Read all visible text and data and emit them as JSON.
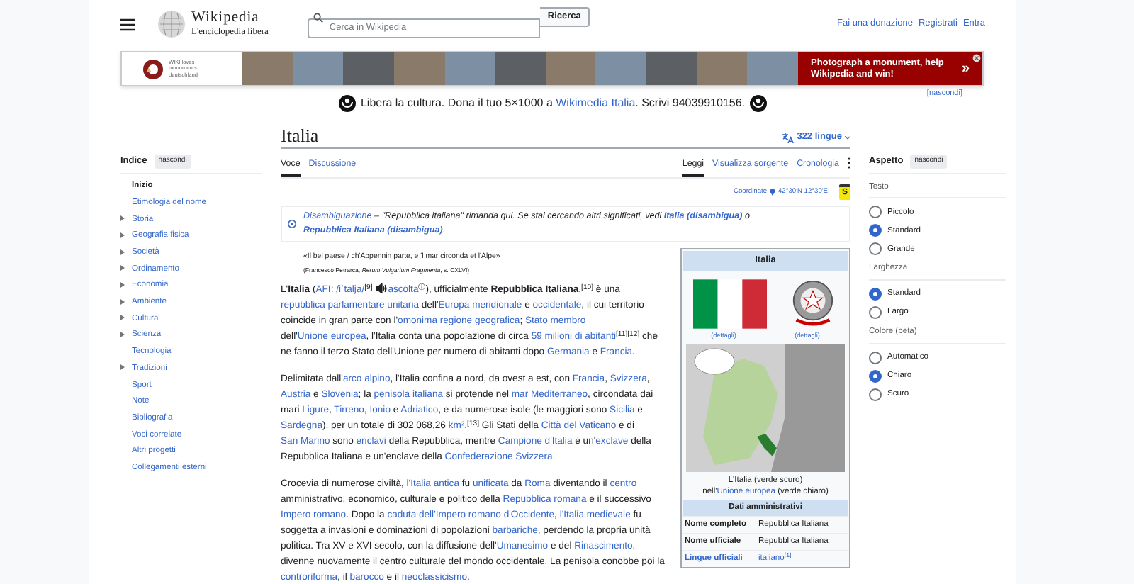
{
  "header": {
    "logo_title": "Wikipedia",
    "logo_tagline": "L'enciclopedia libera",
    "search": {
      "placeholder": "Cerca in Wikipedia",
      "button": "Ricerca"
    },
    "links": [
      "Fai una donazione",
      "Registrati",
      "Entra"
    ]
  },
  "banner": {
    "logo_words": [
      "WIKI loves",
      "monuments",
      "deutschland"
    ],
    "cta": "Photograph a monument, help Wikipedia and win!",
    "cta_arrow": "»"
  },
  "notice": {
    "before": "Libera la cultura. Dona il tuo 5×1000 a ",
    "link": "Wikimedia Italia",
    "after": ". Scrivi 94039910156.",
    "hide": "[nascondi]"
  },
  "toc": {
    "title": "Indice",
    "hide": "nascondi",
    "items": [
      {
        "label": "Inizio",
        "selected": true,
        "expandable": false
      },
      {
        "label": "Etimologia del nome",
        "selected": false,
        "expandable": false
      },
      {
        "label": "Storia",
        "selected": false,
        "expandable": true
      },
      {
        "label": "Geografia fisica",
        "selected": false,
        "expandable": true
      },
      {
        "label": "Società",
        "selected": false,
        "expandable": true
      },
      {
        "label": "Ordinamento",
        "selected": false,
        "expandable": true
      },
      {
        "label": "Economia",
        "selected": false,
        "expandable": true
      },
      {
        "label": "Ambiente",
        "selected": false,
        "expandable": true
      },
      {
        "label": "Cultura",
        "selected": false,
        "expandable": true
      },
      {
        "label": "Scienza",
        "selected": false,
        "expandable": true
      },
      {
        "label": "Tecnologia",
        "selected": false,
        "expandable": false
      },
      {
        "label": "Tradizioni",
        "selected": false,
        "expandable": true
      },
      {
        "label": "Sport",
        "selected": false,
        "expandable": false
      },
      {
        "label": "Note",
        "selected": false,
        "expandable": false
      },
      {
        "label": "Bibliografia",
        "selected": false,
        "expandable": false
      },
      {
        "label": "Voci correlate",
        "selected": false,
        "expandable": false
      },
      {
        "label": "Altri progetti",
        "selected": false,
        "expandable": false
      },
      {
        "label": "Collegamenti esterni",
        "selected": false,
        "expandable": false
      }
    ]
  },
  "article": {
    "title": "Italia",
    "languages": "322 lingue",
    "tabs_left": [
      {
        "label": "Voce",
        "selected": true
      },
      {
        "label": "Discussione",
        "selected": false
      }
    ],
    "tabs_right": [
      {
        "label": "Leggi",
        "selected": true
      },
      {
        "label": "Visualizza sorgente",
        "selected": false
      },
      {
        "label": "Cronologia",
        "selected": false
      }
    ],
    "coordinates": {
      "label": "Coordinate",
      "value": "42°30′N 12°30′E",
      "protection": "S"
    },
    "hatnote": [
      {
        "t": "Disambiguazione",
        "link": true
      },
      {
        "t": " – \"Repubblica italiana\" rimanda qui. Se stai cercando altri significati, vedi ",
        "link": false
      },
      {
        "t": "**Italia (disambigua)**",
        "link": true
      },
      {
        "t": " o ",
        "link": false
      },
      {
        "t": "**Repubblica Italiana (disambigua)**",
        "link": true
      },
      {
        "t": ".",
        "link": false
      }
    ],
    "quote": {
      "text": "«Il bel paese / ch'Appennin parte, e 'l mar circonda et l'Alpe»",
      "source": "(Francesco Petrarca, *Rerum Vulgarium Fragmenta*, s. CXLVI)"
    },
    "paragraphs": [
      [
        {
          "t": "L'**Italia** (",
          "link": false
        },
        {
          "t": "AFI",
          "link": true
        },
        {
          "t": ": ",
          "link": false
        },
        {
          "t": "/iˈtalja/",
          "link": true
        },
        {
          "t": "$^{[9]}$ ",
          "link": false
        },
        {
          "t": "ascolta",
          "link": true,
          "audio": true
        },
        {
          "t": "$^{ⓘ}$), ufficialmente **Repubblica Italiana**,$^{[10]}$ è una ",
          "link": false
        },
        {
          "t": "repubblica parlamentare unitaria",
          "link": true
        },
        {
          "t": " dell'",
          "link": false
        },
        {
          "t": "Europa meridionale",
          "link": true
        },
        {
          "t": " e ",
          "link": false
        },
        {
          "t": "occidentale",
          "link": true
        },
        {
          "t": ", il cui territorio coincide in gran parte con l'",
          "link": false
        },
        {
          "t": "omonima regione geografica",
          "link": true
        },
        {
          "t": "; ",
          "link": false
        },
        {
          "t": "Stato membro",
          "link": true
        },
        {
          "t": " dell'",
          "link": false
        },
        {
          "t": "Unione europea",
          "link": true
        },
        {
          "t": ", l'Italia conta una popolazione di circa ",
          "link": false
        },
        {
          "t": "59 milioni di abitanti",
          "link": true
        },
        {
          "t": "$^{[11][12]}$ che ne fanno il terzo Stato dell'Unione per numero di abitanti dopo ",
          "link": false
        },
        {
          "t": "Germania",
          "link": true
        },
        {
          "t": " e ",
          "link": false
        },
        {
          "t": "Francia",
          "link": true
        },
        {
          "t": ".",
          "link": false
        }
      ],
      [
        {
          "t": "Delimitata dall'",
          "link": false
        },
        {
          "t": "arco alpino",
          "link": true
        },
        {
          "t": ", l'Italia confina a nord, da ovest a est, con ",
          "link": false
        },
        {
          "t": "Francia",
          "link": true
        },
        {
          "t": ", ",
          "link": false
        },
        {
          "t": "Svizzera",
          "link": true
        },
        {
          "t": ", ",
          "link": false
        },
        {
          "t": "Austria",
          "link": true
        },
        {
          "t": " e ",
          "link": false
        },
        {
          "t": "Slovenia",
          "link": true
        },
        {
          "t": "; la ",
          "link": false
        },
        {
          "t": "penisola italiana",
          "link": true
        },
        {
          "t": " si protende nel ",
          "link": false
        },
        {
          "t": "mar Mediterraneo",
          "link": true
        },
        {
          "t": ", circondata dai mari ",
          "link": false
        },
        {
          "t": "Ligure",
          "link": true
        },
        {
          "t": ", ",
          "link": false
        },
        {
          "t": "Tirreno",
          "link": true
        },
        {
          "t": ", ",
          "link": false
        },
        {
          "t": "Ionio",
          "link": true
        },
        {
          "t": " e ",
          "link": false
        },
        {
          "t": "Adriatico",
          "link": true
        },
        {
          "t": ", e da numerose isole (le maggiori sono ",
          "link": false
        },
        {
          "t": "Sicilia",
          "link": true
        },
        {
          "t": " e ",
          "link": false
        },
        {
          "t": "Sardegna",
          "link": true
        },
        {
          "t": "), per un totale di 302 068,26 ",
          "link": false
        },
        {
          "t": "km²",
          "link": true
        },
        {
          "t": ".$^{[13]}$ Gli Stati della ",
          "link": false
        },
        {
          "t": "Città del Vaticano",
          "link": true
        },
        {
          "t": " e di ",
          "link": false
        },
        {
          "t": "San Marino",
          "link": true
        },
        {
          "t": " sono ",
          "link": false
        },
        {
          "t": "enclavi",
          "link": true
        },
        {
          "t": " della Repubblica, mentre ",
          "link": false
        },
        {
          "t": "Campione d'Italia",
          "link": true
        },
        {
          "t": " è un'",
          "link": false
        },
        {
          "t": "exclave",
          "link": true
        },
        {
          "t": " della Repubblica Italiana e un'enclave della ",
          "link": false
        },
        {
          "t": "Confederazione Svizzera",
          "link": true
        },
        {
          "t": ".",
          "link": false
        }
      ],
      [
        {
          "t": "Crocevia di numerose civiltà, ",
          "link": false
        },
        {
          "t": "l'Italia antica",
          "link": true
        },
        {
          "t": " fu ",
          "link": false
        },
        {
          "t": "unificata",
          "link": true
        },
        {
          "t": " da ",
          "link": false
        },
        {
          "t": "Roma",
          "link": true
        },
        {
          "t": " diventando il ",
          "link": false
        },
        {
          "t": "centro",
          "link": true
        },
        {
          "t": " amministrativo, economico, culturale e politico della ",
          "link": false
        },
        {
          "t": "Repubblica romana",
          "link": true
        },
        {
          "t": " e il successivo ",
          "link": false
        },
        {
          "t": "Impero romano",
          "link": true
        },
        {
          "t": ". Dopo la ",
          "link": false
        },
        {
          "t": "caduta dell'Impero romano d'Occidente",
          "link": true
        },
        {
          "t": ", ",
          "link": false
        },
        {
          "t": "l'Italia medievale",
          "link": true
        },
        {
          "t": " fu soggetta a invasioni e dominazioni di popolazioni ",
          "link": false
        },
        {
          "t": "barbariche",
          "link": true
        },
        {
          "t": ", perdendo la propria unità politica. Tra XV e XVI secolo, con la diffusione dell'",
          "link": false
        },
        {
          "t": "Umanesimo",
          "link": true
        },
        {
          "t": " e del ",
          "link": false
        },
        {
          "t": "Rinascimento",
          "link": true
        },
        {
          "t": ", divenne nuovamente il centro culturale del mondo occidentale. La penisola conobbe poi la ",
          "link": false
        },
        {
          "t": "controriforma",
          "link": true
        },
        {
          "t": ", il ",
          "link": false
        },
        {
          "t": "barocco",
          "link": true
        },
        {
          "t": " e il ",
          "link": false
        },
        {
          "t": "neoclassicismo",
          "link": true
        },
        {
          "t": ".",
          "link": false
        }
      ]
    ],
    "infobox": {
      "title": "Italia",
      "image_links": [
        "(dettagli)",
        "(dettagli)"
      ],
      "map_caption": [
        {
          "t": "L'Italia (verde scuro) nell'",
          "link": false
        },
        {
          "t": "Unione europea",
          "link": true
        },
        {
          "t": " (verde chiaro)",
          "link": false
        }
      ],
      "section": "Dati amministrativi",
      "rows": [
        {
          "label": "Nome completo",
          "label_link": false,
          "value": "Repubblica Italiana",
          "value_link": false
        },
        {
          "label": "Nome ufficiale",
          "label_link": false,
          "value": "Repubblica Italiana",
          "value_link": false
        },
        {
          "label": "Lingue ufficiali",
          "label_link": true,
          "value": "italiano$^{[1]}$",
          "value_link": true
        }
      ]
    }
  },
  "appearance": {
    "title": "Aspetto",
    "hide": "nascondi",
    "groups": [
      {
        "title": "Testo",
        "options": [
          {
            "label": "Piccolo",
            "selected": false
          },
          {
            "label": "Standard",
            "selected": true
          },
          {
            "label": "Grande",
            "selected": false
          }
        ]
      },
      {
        "title": "Larghezza",
        "options": [
          {
            "label": "Standard",
            "selected": true
          },
          {
            "label": "Largo",
            "selected": false
          }
        ]
      },
      {
        "title": "Colore (beta)",
        "options": [
          {
            "label": "Automatico",
            "selected": false
          },
          {
            "label": "Chiaro",
            "selected": true
          },
          {
            "label": "Scuro",
            "selected": false
          }
        ]
      }
    ]
  }
}
